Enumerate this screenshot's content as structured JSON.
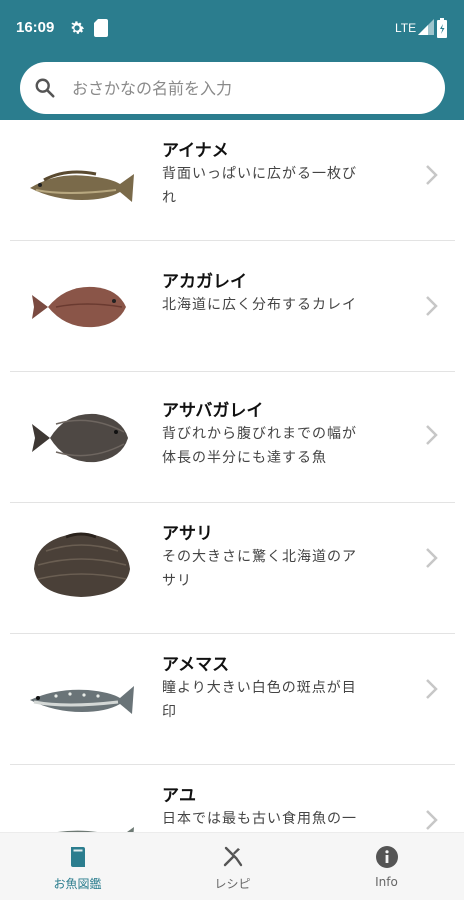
{
  "status_bar": {
    "time": "16:09",
    "network": "LTE",
    "icons": [
      "gear-icon",
      "sd-card-icon",
      "signal-icon",
      "battery-icon"
    ]
  },
  "search": {
    "placeholder": "おさかなの名前を入力",
    "value": "",
    "icon": "search-icon"
  },
  "fish_list": [
    {
      "name": "アイナメ",
      "desc_line1": "背面いっぱいに広がる一枚び",
      "desc_line2": "れ",
      "image": "fish-image"
    },
    {
      "name": "アカガレイ",
      "desc_line1": "北海道に広く分布するカレイ",
      "desc_line2": "",
      "image": "flatfish-image"
    },
    {
      "name": "アサバガレイ",
      "desc_line1": "背びれから腹びれまでの幅が",
      "desc_line2": "体長の半分にも達する魚",
      "image": "flatfish-image"
    },
    {
      "name": "アサリ",
      "desc_line1": "その大きさに驚く北海道のア",
      "desc_line2": "サリ",
      "image": "clam-image"
    },
    {
      "name": "アメマス",
      "desc_line1": "瞳より大きい白色の斑点が目",
      "desc_line2": "印",
      "image": "trout-image"
    },
    {
      "name": "アユ",
      "desc_line1": "日本では最も古い食用魚の一",
      "desc_line2": "",
      "image": "fish-image"
    }
  ],
  "bottom_nav": [
    {
      "label": "お魚図鑑",
      "icon": "book-icon",
      "active": true
    },
    {
      "label": "レシピ",
      "icon": "utensils-icon",
      "active": false
    },
    {
      "label": "Info",
      "icon": "info-icon",
      "active": false
    }
  ],
  "colors": {
    "primary": "#2b7d8e",
    "active_nav": "#2b7d8e",
    "divider": "#e3e3e3"
  }
}
